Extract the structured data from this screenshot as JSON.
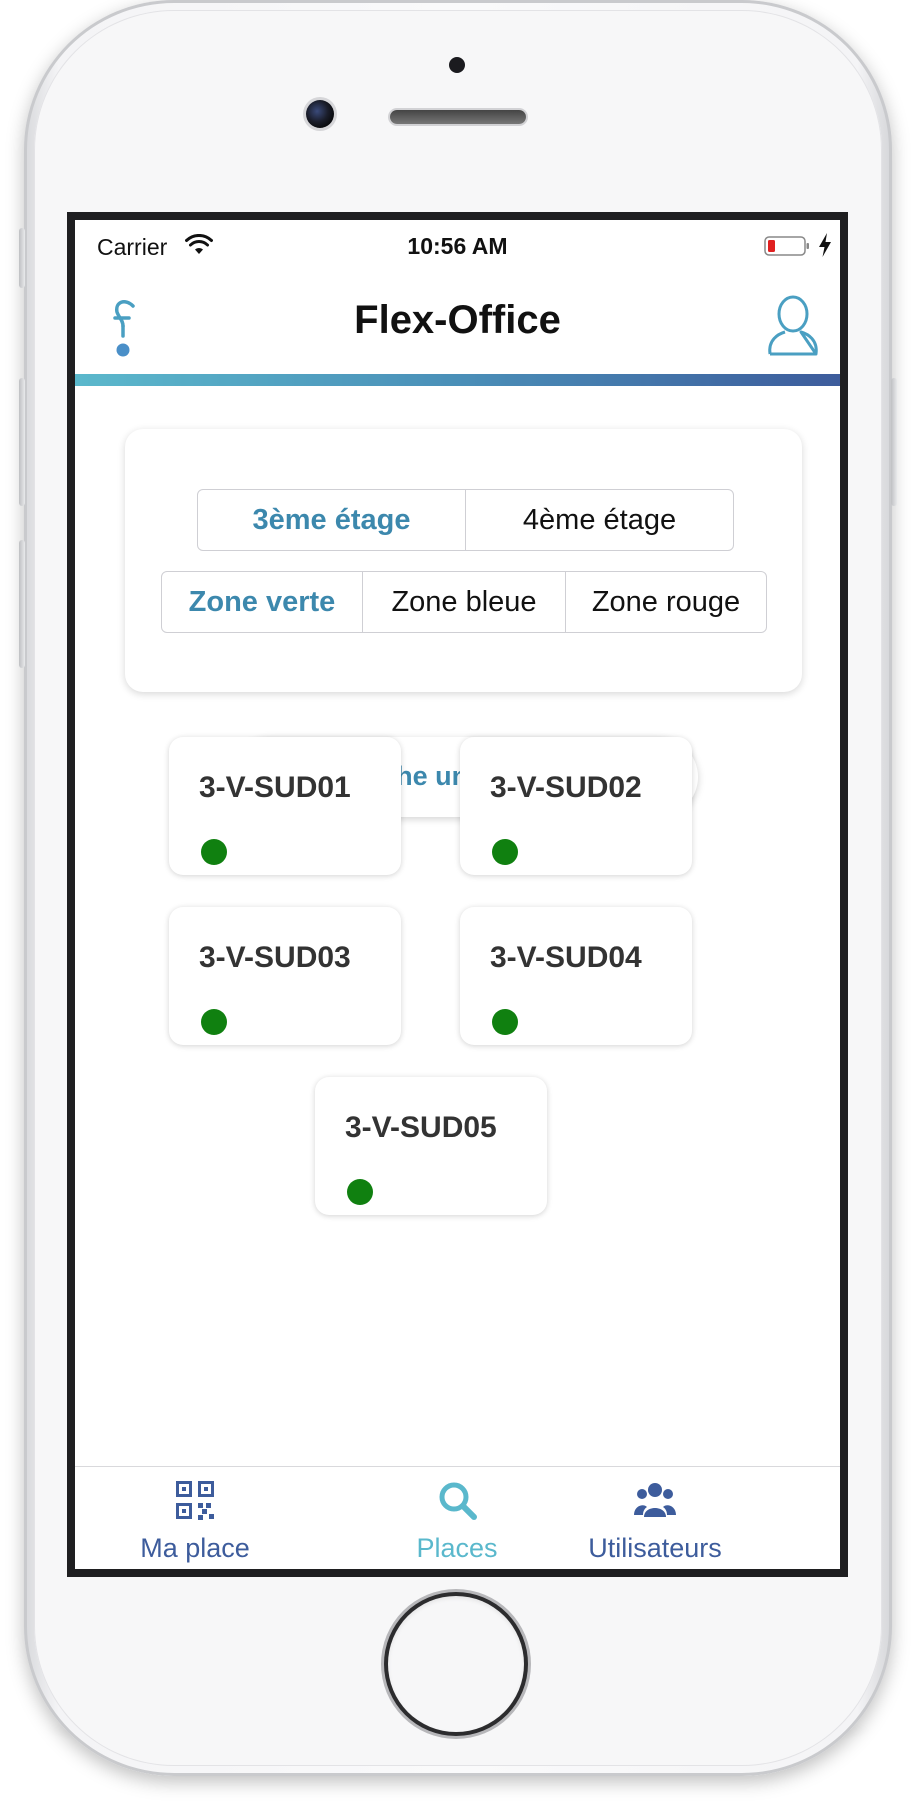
{
  "status_bar": {
    "carrier": "Carrier",
    "time": "10:56 AM"
  },
  "nav": {
    "title": "Flex-Office",
    "logo_icon": "flex-office-logo-icon",
    "profile_icon": "user-profile-icon"
  },
  "filters": {
    "floors": [
      {
        "label": "3ème étage",
        "selected": true
      },
      {
        "label": "4ème étage",
        "selected": false
      }
    ],
    "zones": [
      {
        "label": "Zone verte",
        "selected": true
      },
      {
        "label": "Zone bleue",
        "selected": false
      },
      {
        "label": "Zone rouge",
        "selected": false
      }
    ]
  },
  "search_button": {
    "label": "Je recherche une place",
    "icon": "arrow-right-icon"
  },
  "desks": [
    {
      "name": "3-V-SUD01",
      "status": "available"
    },
    {
      "name": "3-V-SUD02",
      "status": "available"
    },
    {
      "name": "3-V-SUD03",
      "status": "available"
    },
    {
      "name": "3-V-SUD04",
      "status": "available"
    },
    {
      "name": "3-V-SUD05",
      "status": "available"
    }
  ],
  "tab_bar": {
    "items": [
      {
        "label": "Ma place",
        "icon": "qr-code-icon",
        "active": false
      },
      {
        "label": "Places",
        "icon": "search-icon",
        "active": true
      },
      {
        "label": "Utilisateurs",
        "icon": "users-icon",
        "active": false
      }
    ]
  },
  "colors": {
    "accent": "#3c88ad",
    "active_tab": "#5ab8cc",
    "inactive_tab": "#3d5c9c",
    "available": "#108010"
  }
}
